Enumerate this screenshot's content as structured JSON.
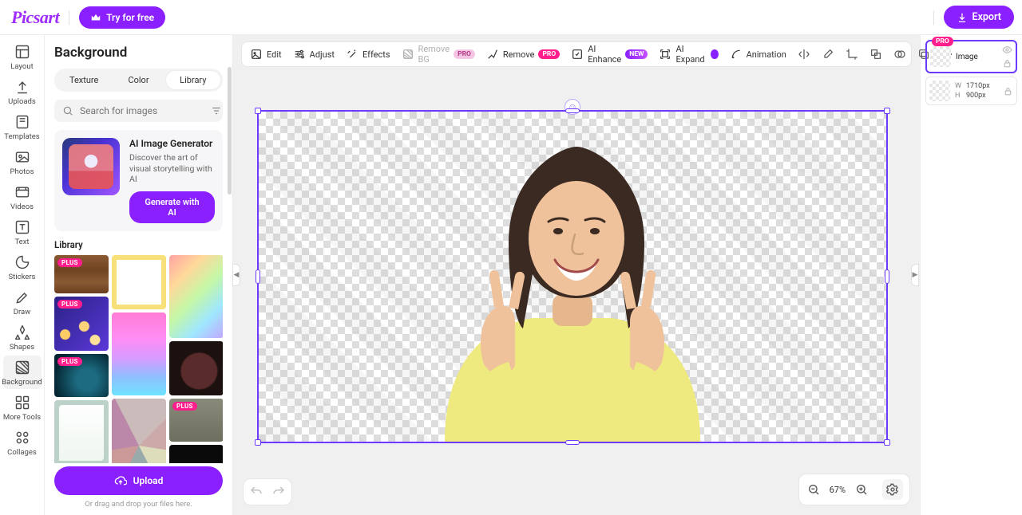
{
  "brand": "Picsart",
  "topbar": {
    "try_label": "Try for free",
    "export_label": "Export"
  },
  "rail": {
    "items": [
      {
        "key": "layout",
        "label": "Layout"
      },
      {
        "key": "uploads",
        "label": "Uploads"
      },
      {
        "key": "templates",
        "label": "Templates"
      },
      {
        "key": "photos",
        "label": "Photos"
      },
      {
        "key": "videos",
        "label": "Videos"
      },
      {
        "key": "text",
        "label": "Text"
      },
      {
        "key": "stickers",
        "label": "Stickers"
      },
      {
        "key": "draw",
        "label": "Draw"
      },
      {
        "key": "shapes",
        "label": "Shapes"
      },
      {
        "key": "background",
        "label": "Background"
      },
      {
        "key": "moretools",
        "label": "More Tools"
      },
      {
        "key": "collages",
        "label": "Collages"
      }
    ],
    "active": "background"
  },
  "panel": {
    "title": "Background",
    "tabs": {
      "texture": "Texture",
      "color": "Color",
      "library": "Library",
      "active": "library"
    },
    "search_placeholder": "Search for images",
    "aigen": {
      "title": "AI Image Generator",
      "subtitle": "Discover the art of visual storytelling with AI",
      "button": "Generate with AI"
    },
    "library_title": "Library",
    "plus_label": "PLUS",
    "upload_label": "Upload",
    "drag_hint": "Or drag and drop your files here."
  },
  "toolbar": {
    "edit": "Edit",
    "adjust": "Adjust",
    "effects": "Effects",
    "remove_bg": "Remove BG",
    "remove": "Remove",
    "ai_enhance": "AI Enhance",
    "ai_expand": "AI Expand",
    "animation": "Animation",
    "pro_label": "PRO",
    "new_label": "NEW"
  },
  "layers": {
    "image_label": "Image",
    "pro_label": "PRO",
    "w_label": "W",
    "w_value": "1710px",
    "h_label": "H",
    "h_value": "900px"
  },
  "zoom": {
    "value": "67%"
  }
}
